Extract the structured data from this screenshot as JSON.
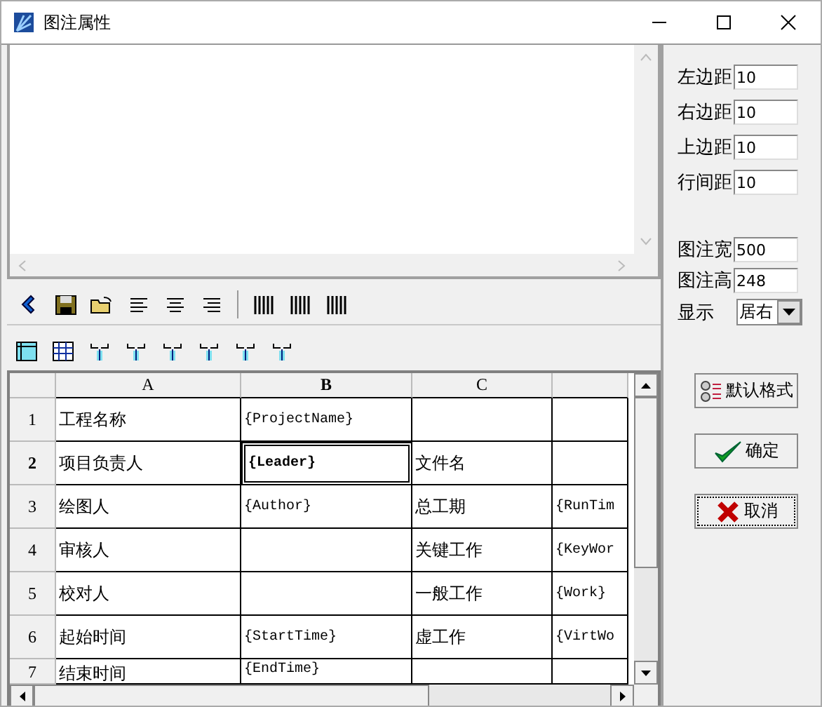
{
  "window": {
    "title": "图注属性"
  },
  "grid": {
    "columns": [
      {
        "label": "A",
        "selected": false
      },
      {
        "label": "B",
        "selected": true
      },
      {
        "label": "C",
        "selected": false
      }
    ],
    "rows": [
      {
        "header": "1",
        "selected": false,
        "cells": [
          {
            "text": "工程名称",
            "selected": false
          },
          {
            "text": "{ProjectName}",
            "selected": false
          },
          {
            "text": "",
            "selected": false
          },
          {
            "text": "",
            "selected": false
          }
        ]
      },
      {
        "header": "2",
        "selected": true,
        "cells": [
          {
            "text": "项目负责人",
            "selected": false
          },
          {
            "text": "{Leader}",
            "selected": true
          },
          {
            "text": "文件名",
            "selected": false
          },
          {
            "text": "",
            "selected": false
          }
        ]
      },
      {
        "header": "3",
        "selected": false,
        "cells": [
          {
            "text": "绘图人",
            "selected": false
          },
          {
            "text": "{Author}",
            "selected": false
          },
          {
            "text": "总工期",
            "selected": false
          },
          {
            "text": "{RunTim",
            "selected": false
          }
        ]
      },
      {
        "header": "4",
        "selected": false,
        "cells": [
          {
            "text": "审核人",
            "selected": false
          },
          {
            "text": "",
            "selected": false
          },
          {
            "text": "关键工作",
            "selected": false
          },
          {
            "text": "{KeyWor",
            "selected": false
          }
        ]
      },
      {
        "header": "5",
        "selected": false,
        "cells": [
          {
            "text": "校对人",
            "selected": false
          },
          {
            "text": "",
            "selected": false
          },
          {
            "text": "一般工作",
            "selected": false
          },
          {
            "text": "{Work}",
            "selected": false
          }
        ]
      },
      {
        "header": "6",
        "selected": false,
        "cells": [
          {
            "text": "起始时间",
            "selected": false
          },
          {
            "text": "{StartTime}",
            "selected": false
          },
          {
            "text": "虚工作",
            "selected": false
          },
          {
            "text": "{VirtWo",
            "selected": false
          }
        ]
      },
      {
        "header": "7",
        "selected": false,
        "cells": [
          {
            "text": "结束时间",
            "selected": false
          },
          {
            "text": "{EndTime}",
            "selected": false
          },
          {
            "text": "",
            "selected": false
          },
          {
            "text": "",
            "selected": false
          }
        ]
      }
    ]
  },
  "margins": [
    {
      "label": "左边距",
      "value": "10"
    },
    {
      "label": "右边距",
      "value": "10"
    },
    {
      "label": "上边距",
      "value": "10"
    },
    {
      "label": "行间距",
      "value": "10"
    }
  ],
  "size": [
    {
      "label": "图注宽",
      "value": "500"
    },
    {
      "label": "图注高",
      "value": "248"
    }
  ],
  "display": {
    "label": "显示",
    "value": "居右"
  },
  "buttons": [
    {
      "kind": "default",
      "label": "默认格式"
    },
    {
      "kind": "ok",
      "label": "确定"
    },
    {
      "kind": "cancel",
      "label": "取消"
    }
  ]
}
